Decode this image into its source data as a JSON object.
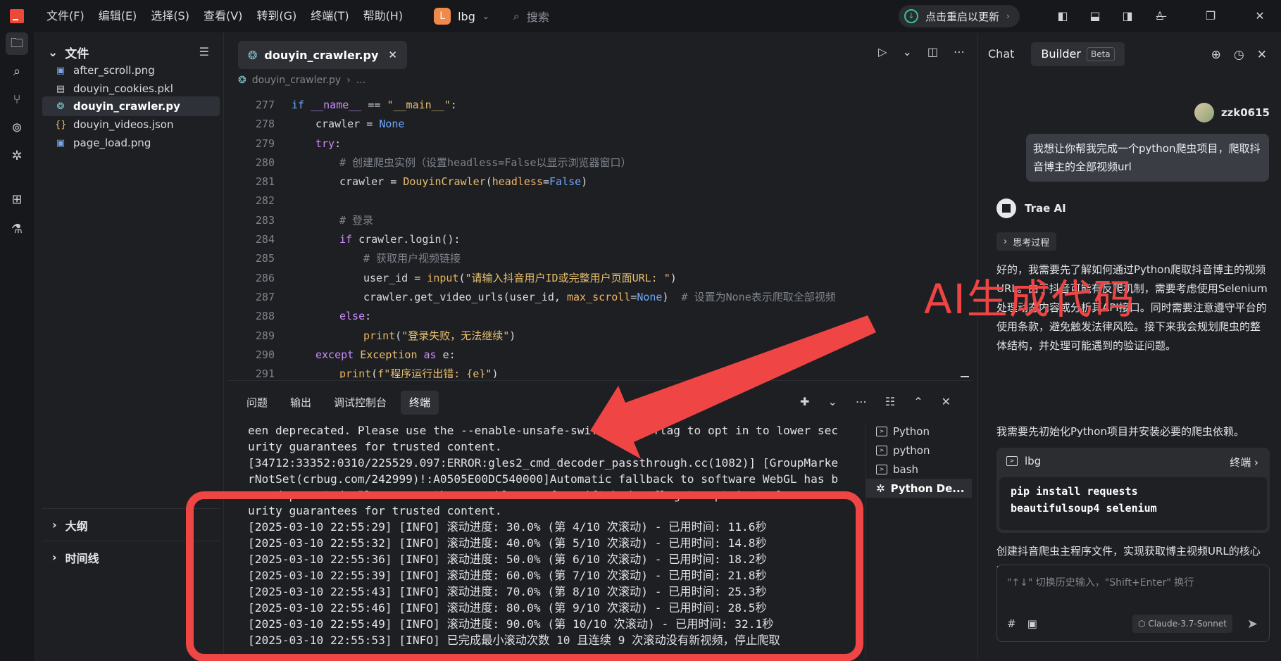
{
  "titlebar": {
    "menu": [
      "文件(F)",
      "编辑(E)",
      "选择(S)",
      "查看(V)",
      "转到(G)",
      "终端(T)",
      "帮助(H)"
    ],
    "project_badge": "L",
    "project_name": "lbg",
    "search_placeholder": "搜索",
    "update_label": "点击重启以更新"
  },
  "explorer": {
    "title": "文件",
    "files": [
      {
        "name": "after_scroll.png",
        "icon": "image-icon"
      },
      {
        "name": "douyin_cookies.pkl",
        "icon": "file-icon"
      },
      {
        "name": "douyin_crawler.py",
        "icon": "python-icon",
        "active": true
      },
      {
        "name": "douyin_videos.json",
        "icon": "json-icon"
      },
      {
        "name": "page_load.png",
        "icon": "image-icon"
      }
    ],
    "outline_label": "大纲",
    "timeline_label": "时间线"
  },
  "editor": {
    "tab_label": "douyin_crawler.py",
    "breadcrumb_file": "douyin_crawler.py",
    "breadcrumb_more": "...",
    "line_numbers": [
      "277",
      "278",
      "279",
      "280",
      "281",
      "282",
      "283",
      "284",
      "285",
      "286",
      "287",
      "288",
      "289",
      "290",
      "291"
    ],
    "code": {
      "l277": [
        "if ",
        "__name__",
        " == ",
        "\"__main__\"",
        ":"
      ],
      "l278": [
        "crawler",
        " = ",
        "None"
      ],
      "l279": [
        "try",
        ":"
      ],
      "l280": "# 创建爬虫实例（设置headless=False以显示浏览器窗口）",
      "l281": [
        "crawler = ",
        "DouyinCrawler",
        "(",
        "headless",
        "=",
        "False",
        ")"
      ],
      "l283": "# 登录",
      "l284": [
        "if ",
        "crawler.login():"
      ],
      "l285": "# 获取用户视频链接",
      "l286": [
        "user_id = ",
        "input",
        "(",
        "\"请输入抖音用户ID或完整用户页面URL: \"",
        ")"
      ],
      "l287": [
        "crawler.get_video_urls(user_id, ",
        "max_scroll",
        "=",
        "None",
        ")  ",
        "# 设置为None表示爬取全部视频"
      ],
      "l288": [
        "else",
        ":"
      ],
      "l289": [
        "print",
        "(",
        "\"登录失败，无法继续\"",
        ")"
      ],
      "l290": [
        "except ",
        "Exception",
        " as ",
        "e:"
      ],
      "l291": [
        "print",
        "(",
        "f\"程序运行出错: {e}\"",
        ")"
      ]
    }
  },
  "panel": {
    "tabs": [
      "问题",
      "输出",
      "调试控制台",
      "终端"
    ],
    "terminal_lines": [
      "een deprecated. Please use the --enable-unsafe-swiftshader flag to opt in to lower sec",
      "urity guarantees for trusted content.",
      "[34712:33352:0310/225529.097:ERROR:gles2_cmd_decoder_passthrough.cc(1082)] [GroupMarke",
      "rNotSet(crbug.com/242999)!:A0505E00DC540000]Automatic fallback to software WebGL has b",
      "een deprecated. Please use the --enable-unsafe-swiftshader flag to opt in to lower sec",
      "urity guarantees for trusted content.",
      "[2025-03-10 22:55:29] [INFO] 滚动进度: 30.0% (第 4/10 次滚动) - 已用时间: 11.6秒",
      "[2025-03-10 22:55:32] [INFO] 滚动进度: 40.0% (第 5/10 次滚动) - 已用时间: 14.8秒",
      "[2025-03-10 22:55:36] [INFO] 滚动进度: 50.0% (第 6/10 次滚动) - 已用时间: 18.2秒",
      "[2025-03-10 22:55:39] [INFO] 滚动进度: 60.0% (第 7/10 次滚动) - 已用时间: 21.8秒",
      "[2025-03-10 22:55:43] [INFO] 滚动进度: 70.0% (第 8/10 次滚动) - 已用时间: 25.3秒",
      "[2025-03-10 22:55:46] [INFO] 滚动进度: 80.0% (第 9/10 次滚动) - 已用时间: 28.5秒",
      "[2025-03-10 22:55:49] [INFO] 滚动进度: 90.0% (第 10/10 次滚动) - 已用时间: 32.1秒",
      "[2025-03-10 22:55:53] [INFO] 已完成最小滚动次数 10 且连续 9 次滚动没有新视频，停止爬取"
    ],
    "terminals": [
      "Python",
      "python",
      "bash",
      "Python De..."
    ]
  },
  "chat": {
    "tabs": [
      "Chat",
      "Builder"
    ],
    "beta_label": "Beta",
    "username": "zzk0615",
    "user_message": "我想让你帮我完成一个python爬虫项目，爬取抖音博主的全部视频url",
    "ai_name": "Trae AI",
    "think_label": "思考过程",
    "para1": "好的，我需要先了解如何通过Python爬取抖音博主的视频URL。由于抖音可能有反爬机制，需要考虑使用Selenium处理动态内容或分析其API接口。同时需要注意遵守平台的使用条款，避免触发法律风险。接下来我会规划爬虫的整体结构，并处理可能遇到的验证问题。",
    "para2": "我需要先初始化Python项目并安装必要的爬虫依赖。",
    "cmd_cwd": "lbg",
    "cmd_terminal_label": "终端",
    "cmd_lines": [
      "pip install requests",
      "beautifulsoup4 selenium"
    ],
    "para3": "创建抖音爬虫主程序文件，实现获取博主视频URL的核心功能。",
    "input_placeholder": "\"↑↓\" 切换历史输入，\"Shift+Enter\" 换行",
    "model": "Claude-3.7-Sonnet"
  },
  "annotation": {
    "text": "AI生成代码",
    "color": "#ef4444"
  }
}
